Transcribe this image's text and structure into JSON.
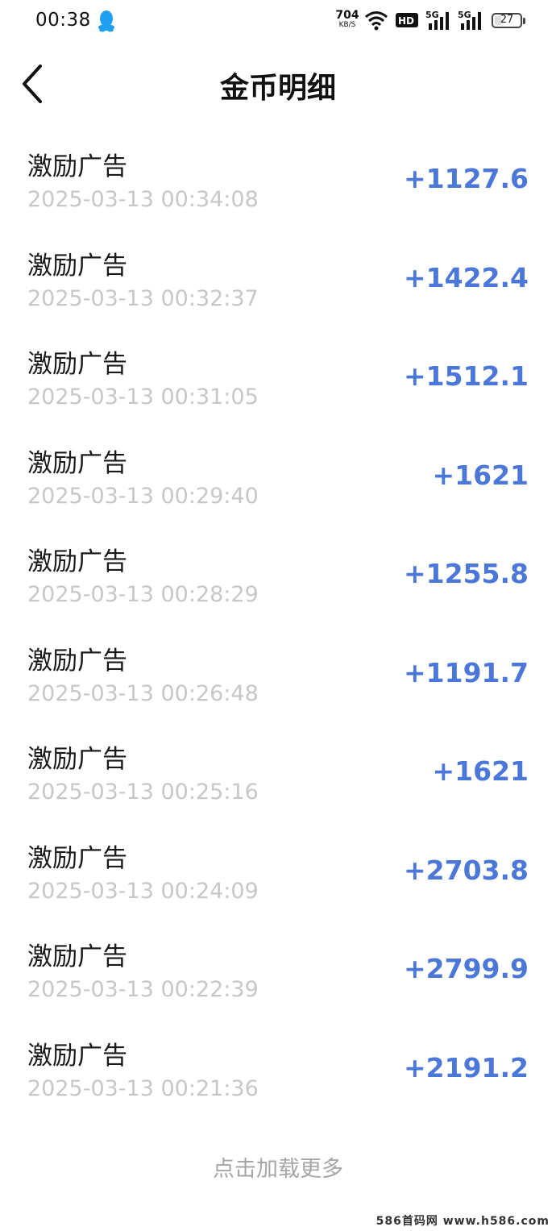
{
  "status_bar": {
    "time": "00:38",
    "net_speed_value": "704",
    "net_speed_unit": "KB/S",
    "battery": "27",
    "battery_level": 0.27,
    "icons": [
      "qq-icon",
      "wifi-icon",
      "hd-icon",
      "5g-signal-icon",
      "5g-signal-icon"
    ]
  },
  "header": {
    "title": "金币明细",
    "back_icon": "chevron-left-icon"
  },
  "records": [
    {
      "title": "激励广告",
      "time": "2025-03-13 00:34:08",
      "amount": "+1127.6"
    },
    {
      "title": "激励广告",
      "time": "2025-03-13 00:32:37",
      "amount": "+1422.4"
    },
    {
      "title": "激励广告",
      "time": "2025-03-13 00:31:05",
      "amount": "+1512.1"
    },
    {
      "title": "激励广告",
      "time": "2025-03-13 00:29:40",
      "amount": "+1621"
    },
    {
      "title": "激励广告",
      "time": "2025-03-13 00:28:29",
      "amount": "+1255.8"
    },
    {
      "title": "激励广告",
      "time": "2025-03-13 00:26:48",
      "amount": "+1191.7"
    },
    {
      "title": "激励广告",
      "time": "2025-03-13 00:25:16",
      "amount": "+1621"
    },
    {
      "title": "激励广告",
      "time": "2025-03-13 00:24:09",
      "amount": "+2703.8"
    },
    {
      "title": "激励广告",
      "time": "2025-03-13 00:22:39",
      "amount": "+2799.9"
    },
    {
      "title": "激励广告",
      "time": "2025-03-13 00:21:36",
      "amount": "+2191.2"
    }
  ],
  "load_more": "点击加载更多",
  "watermark": "586首码网 www.h586.com",
  "colors": {
    "amount": "#4a77d8",
    "time": "#c7c7c7",
    "load_more": "#a6a6a6"
  }
}
